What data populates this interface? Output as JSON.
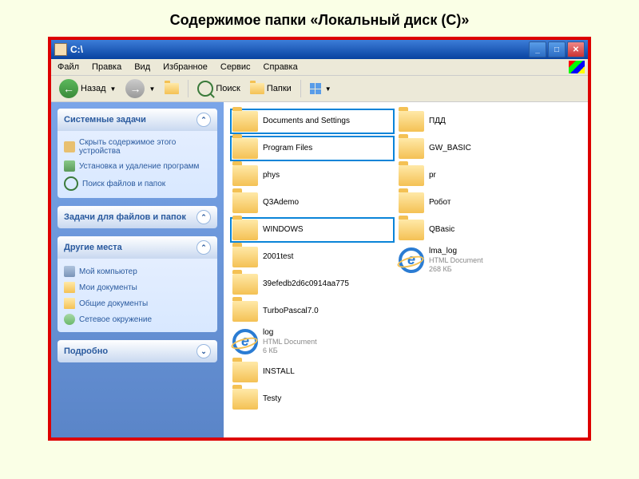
{
  "pageTitle": "Содержимое папки «Локальный диск (С)»",
  "window": {
    "title": "C:\\"
  },
  "menu": {
    "file": "Файл",
    "edit": "Правка",
    "view": "Вид",
    "favorites": "Избранное",
    "tools": "Сервис",
    "help": "Справка"
  },
  "toolbar": {
    "back": "Назад",
    "search": "Поиск",
    "folders": "Папки"
  },
  "sidebar": {
    "systemTasks": {
      "title": "Системные задачи",
      "items": [
        "Скрыть содержимое этого устройства",
        "Установка и удаление программ",
        "Поиск файлов и папок"
      ]
    },
    "fileTasks": {
      "title": "Задачи для файлов и папок"
    },
    "otherPlaces": {
      "title": "Другие места",
      "items": [
        "Мой компьютер",
        "Мои документы",
        "Общие документы",
        "Сетевое окружение"
      ]
    },
    "details": {
      "title": "Подробно"
    }
  },
  "files": {
    "col1": [
      {
        "name": "Documents and Settings",
        "type": "folder",
        "hl": true
      },
      {
        "name": "Program Files",
        "type": "folder",
        "hl": true
      },
      {
        "name": "phys",
        "type": "folder"
      },
      {
        "name": "Q3Ademo",
        "type": "folder"
      },
      {
        "name": "WINDOWS",
        "type": "folder",
        "hl": true
      },
      {
        "name": "2001test",
        "type": "folder"
      },
      {
        "name": "39efedb2d6c0914aa775",
        "type": "folder"
      },
      {
        "name": "TurboPascal7.0",
        "type": "folder"
      },
      {
        "name": "log",
        "type": "ie",
        "meta1": "HTML Document",
        "meta2": "6 КБ"
      }
    ],
    "col2": [
      {
        "name": "INSTALL",
        "type": "folder"
      },
      {
        "name": "Testy",
        "type": "folder"
      },
      {
        "name": "ПДД",
        "type": "folder"
      },
      {
        "name": "GW_BASIC",
        "type": "folder"
      },
      {
        "name": "pr",
        "type": "folder"
      },
      {
        "name": "Робот",
        "type": "folder"
      },
      {
        "name": "QBasic",
        "type": "folder"
      },
      {
        "name": "lma_log",
        "type": "ie",
        "meta1": "HTML Document",
        "meta2": "268 КБ"
      }
    ]
  }
}
